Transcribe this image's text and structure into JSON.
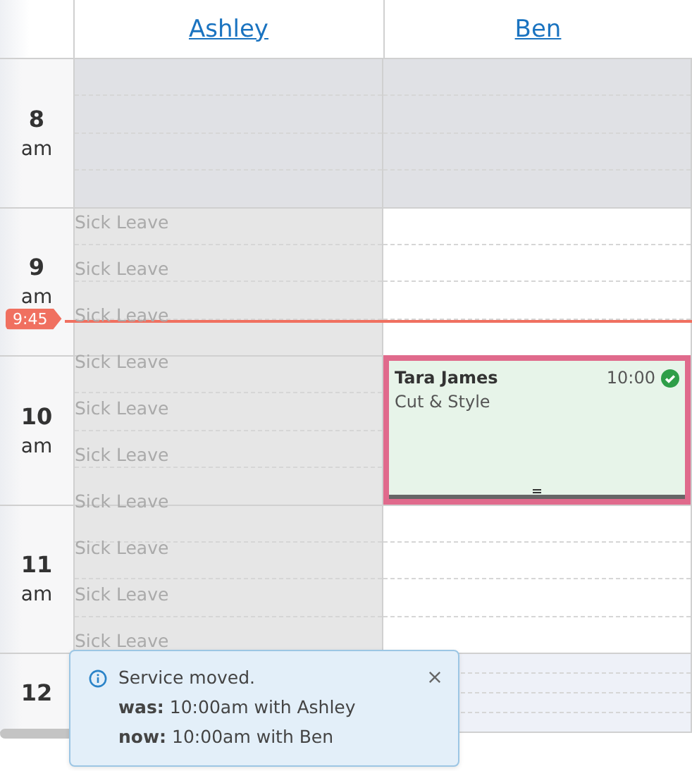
{
  "columns": [
    {
      "name": "Ashley",
      "on_leave": true,
      "leave_labels": [
        "Sick Leave",
        "Sick Leave",
        "Sick Leave",
        "Sick Leave",
        "Sick Leave",
        "Sick Leave",
        "Sick Leave",
        "Sick Leave",
        "Sick Leave",
        "Sick Leave"
      ]
    },
    {
      "name": "Ben",
      "on_leave": false,
      "appointments": [
        {
          "client": "Tara James",
          "service": "Cut & Style",
          "time": "10:00",
          "confirmed": true,
          "selected": true
        }
      ]
    }
  ],
  "hours": [
    {
      "hour": "8",
      "period": "am",
      "closed": true,
      "highlighted": false
    },
    {
      "hour": "9",
      "period": "am",
      "closed": false,
      "highlighted": false
    },
    {
      "hour": "10",
      "period": "am",
      "closed": false,
      "highlighted": false
    },
    {
      "hour": "11",
      "period": "am",
      "closed": false,
      "highlighted": false
    },
    {
      "hour": "12",
      "closed": false,
      "highlighted": true
    }
  ],
  "now_marker": {
    "label": "9:45"
  },
  "toast": {
    "message": "Service moved.",
    "lines": [
      {
        "label": "was:",
        "text": "10:00am with Ashley"
      },
      {
        "label": "now:",
        "text": "10:00am with Ben"
      }
    ]
  }
}
